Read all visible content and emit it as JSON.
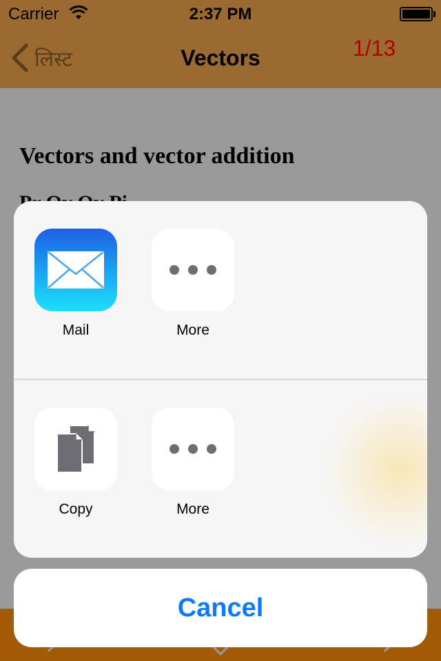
{
  "status_bar": {
    "carrier": "Carrier",
    "time": "2:37 PM"
  },
  "nav": {
    "back_label": "लिस्ट",
    "title": "Vectors",
    "page_counter": "1/13"
  },
  "content": {
    "heading": "Vectors and vector addition",
    "subheading": "Pr Ov Ov Pi"
  },
  "share_sheet": {
    "row1": [
      {
        "label": "Mail",
        "icon": "mail-icon"
      },
      {
        "label": "More",
        "icon": "more-icon"
      }
    ],
    "row2": [
      {
        "label": "Copy",
        "icon": "copy-icon"
      },
      {
        "label": "More",
        "icon": "more-icon"
      }
    ],
    "cancel_label": "Cancel"
  },
  "colors": {
    "nav_bar": "#9a6a30",
    "page_counter": "#b00000",
    "accent": "#0a7aff",
    "bottom_bar": "#a35a06"
  }
}
